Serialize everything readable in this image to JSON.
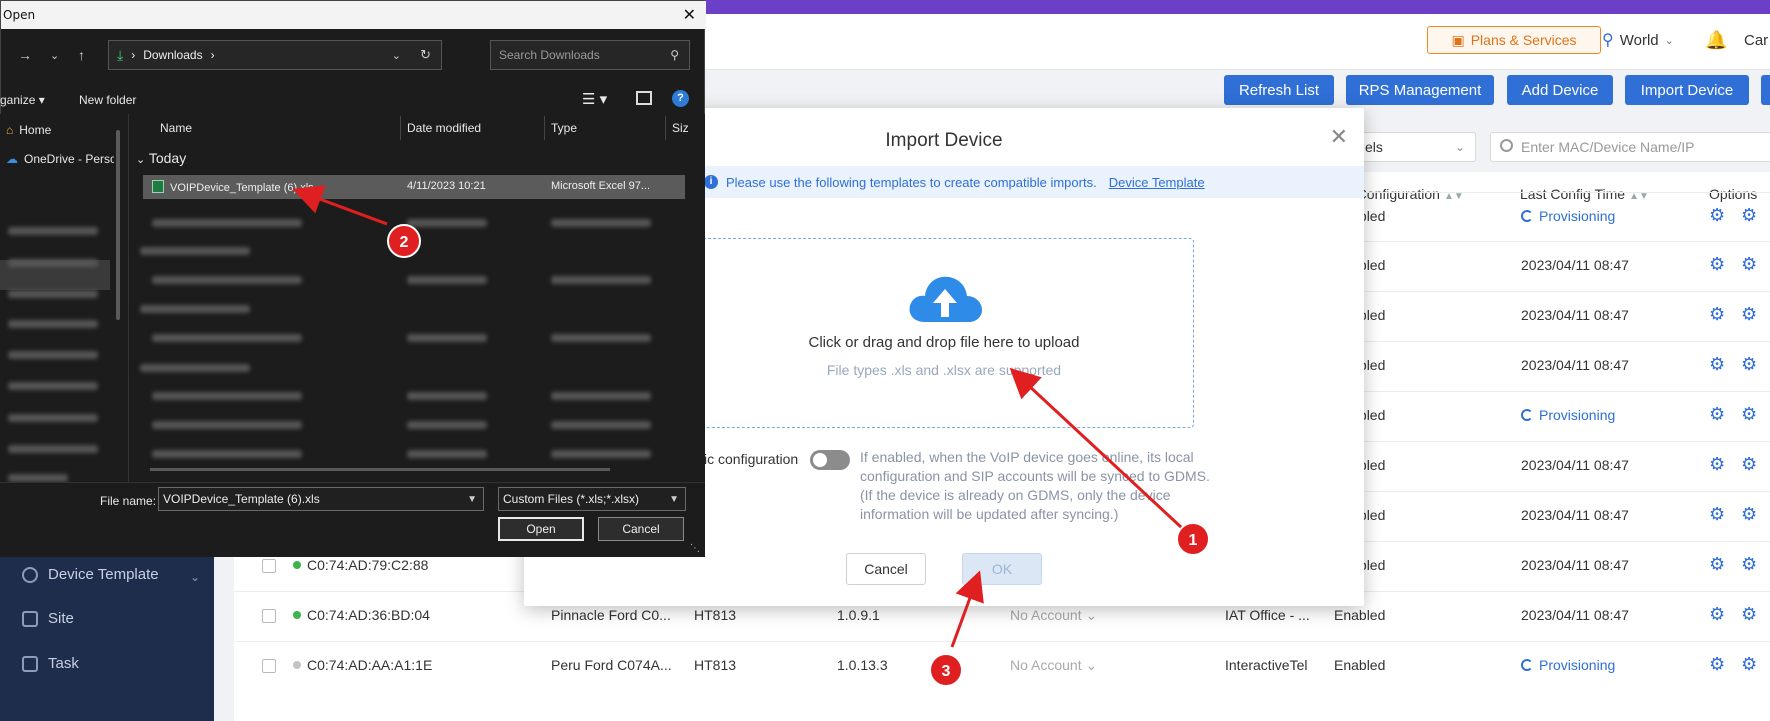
{
  "header": {
    "plans_label": "Plans & Services",
    "region": "World",
    "user_truncated": "Car"
  },
  "actions": [
    {
      "label": "Refresh List"
    },
    {
      "label": "RPS Management"
    },
    {
      "label": "Add Device"
    },
    {
      "label": "Import Device"
    }
  ],
  "filters": {
    "model_select_partial": "els",
    "search_placeholder": "Enter MAC/Device Name/IP"
  },
  "sidebar": {
    "items": [
      {
        "label": "Device Template"
      },
      {
        "label": "Site"
      },
      {
        "label": "Task"
      }
    ]
  },
  "table": {
    "headers": {
      "config_partial": "n Configuration",
      "last_config_time": "Last Config Time",
      "options": "Options"
    },
    "rows": [
      {
        "config": "Enabled",
        "time": "Provisioning",
        "provisioning": true
      },
      {
        "config": "Enabled",
        "time": "2023/04/11 08:47"
      },
      {
        "config": "Enabled",
        "time": "2023/04/11 08:47"
      },
      {
        "config": "Enabled",
        "time": "2023/04/11 08:47"
      },
      {
        "config": "Enabled",
        "time": "Provisioning",
        "provisioning": true
      },
      {
        "config": "Enabled",
        "time": "2023/04/11 08:47"
      },
      {
        "config": "Enabled",
        "time": "2023/04/11 08:47"
      },
      {
        "mac": "C0:74:AD:79:C2:88",
        "status": "online",
        "config": "Enabled",
        "time": "2023/04/11 08:47"
      },
      {
        "mac": "C0:74:AD:36:BD:04",
        "status": "online",
        "name": "Pinnacle Ford C0...",
        "model": "HT813",
        "firmware": "1.0.9.1",
        "account": "No Account",
        "site": "IAT Office - ...",
        "config": "Enabled",
        "time": "2023/04/11 08:47"
      },
      {
        "mac": "C0:74:AD:AA:A1:1E",
        "status": "offline",
        "name": "Peru Ford C074A...",
        "model": "HT813",
        "firmware": "1.0.13.3",
        "account": "No Account",
        "site": "InteractiveTel",
        "config": "Enabled",
        "time": "Provisioning",
        "provisioning": true
      }
    ]
  },
  "modal": {
    "title": "Import Device",
    "notice": "Please use the following templates to create compatible imports.",
    "notice_link": "Device Template",
    "upload_main": "Click or drag and drop file here to upload",
    "upload_sub": "File types .xls and .xlsx are supported",
    "sync_label_partial": "ic configuration",
    "sync_desc": "If enabled, when the VoIP device goes online, its local configuration and SIP accounts will be synced to GDMS.(If the device is already on GDMS, only the device information will be updated after syncing.)",
    "cancel_label": "Cancel",
    "ok_label": "OK"
  },
  "file_dialog": {
    "title": "Open",
    "address": "Downloads",
    "search_placeholder": "Search Downloads",
    "organize": "ganize",
    "new_folder": "New folder",
    "nav": {
      "home": "Home",
      "onedrive": "OneDrive - Perso"
    },
    "columns": {
      "name": "Name",
      "date_modified": "Date modified",
      "type": "Type",
      "size": "Siz"
    },
    "group_today": "Today",
    "selected_file": {
      "name": "VOIPDevice_Template (6).xls",
      "date": "4/11/2023 10:21",
      "type": "Microsoft Excel 97..."
    },
    "file_name_label": "File name:",
    "file_name_value": "VOIPDevice_Template (6).xls",
    "file_type": "Custom Files (*.xls;*.xlsx)",
    "open_label": "Open",
    "cancel_label": "Cancel"
  },
  "annotations": {
    "step1": "1",
    "step2": "2",
    "step3": "3",
    "color": "#e02020"
  }
}
